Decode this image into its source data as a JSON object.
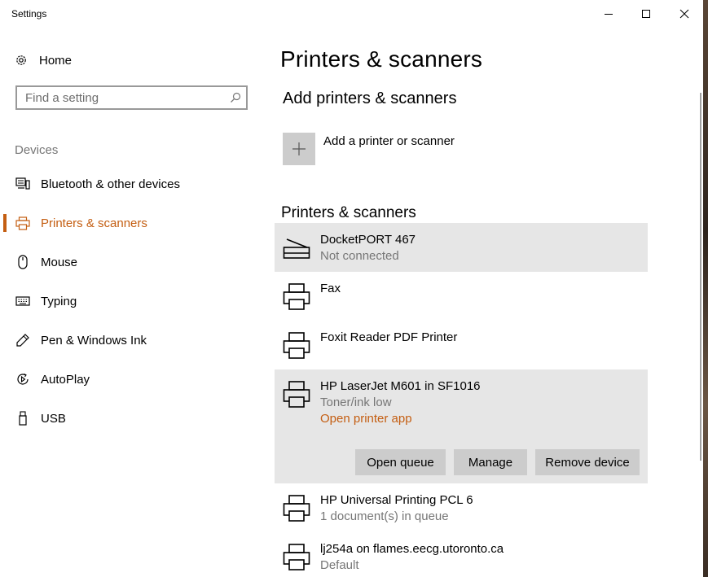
{
  "window": {
    "title": "Settings",
    "controls": {
      "minimize": "minimize-icon",
      "maximize": "maximize-icon",
      "close": "close-icon"
    }
  },
  "sidebar": {
    "home_label": "Home",
    "search_placeholder": "Find a setting",
    "section_header": "Devices",
    "items": [
      {
        "label": "Bluetooth & other devices",
        "icon": "bluetooth-devices-icon",
        "selected": false
      },
      {
        "label": "Printers & scanners",
        "icon": "printer-icon",
        "selected": true
      },
      {
        "label": "Mouse",
        "icon": "mouse-icon",
        "selected": false
      },
      {
        "label": "Typing",
        "icon": "keyboard-icon",
        "selected": false
      },
      {
        "label": "Pen & Windows Ink",
        "icon": "pen-icon",
        "selected": false
      },
      {
        "label": "AutoPlay",
        "icon": "autoplay-icon",
        "selected": false
      },
      {
        "label": "USB",
        "icon": "usb-icon",
        "selected": false
      }
    ]
  },
  "main": {
    "page_title": "Printers & scanners",
    "add_section_title": "Add printers & scanners",
    "add_label": "Add a printer or scanner",
    "list_title": "Printers & scanners",
    "devices": [
      {
        "name": "DocketPORT 467",
        "status": "Not connected",
        "icon": "scanner-icon"
      },
      {
        "name": "Fax",
        "status": "",
        "icon": "printer-icon"
      },
      {
        "name": "Foxit Reader PDF Printer",
        "status": "",
        "icon": "printer-icon"
      },
      {
        "name": "HP LaserJet M601 in SF1016",
        "status": "Toner/ink low",
        "link": "Open printer app",
        "icon": "printer-icon",
        "buttons": {
          "open_queue": "Open queue",
          "manage": "Manage",
          "remove": "Remove device"
        }
      },
      {
        "name": "HP Universal Printing PCL 6",
        "status": "1 document(s) in queue",
        "icon": "printer-icon"
      },
      {
        "name": "lj254a on flames.eecg.utoronto.ca",
        "status": "Default",
        "icon": "printer-icon"
      }
    ]
  },
  "colors": {
    "accent": "#c45e12",
    "selected_bg": "#e6e6e6",
    "button_bg": "#cccccc",
    "secondary_text": "#767676"
  }
}
